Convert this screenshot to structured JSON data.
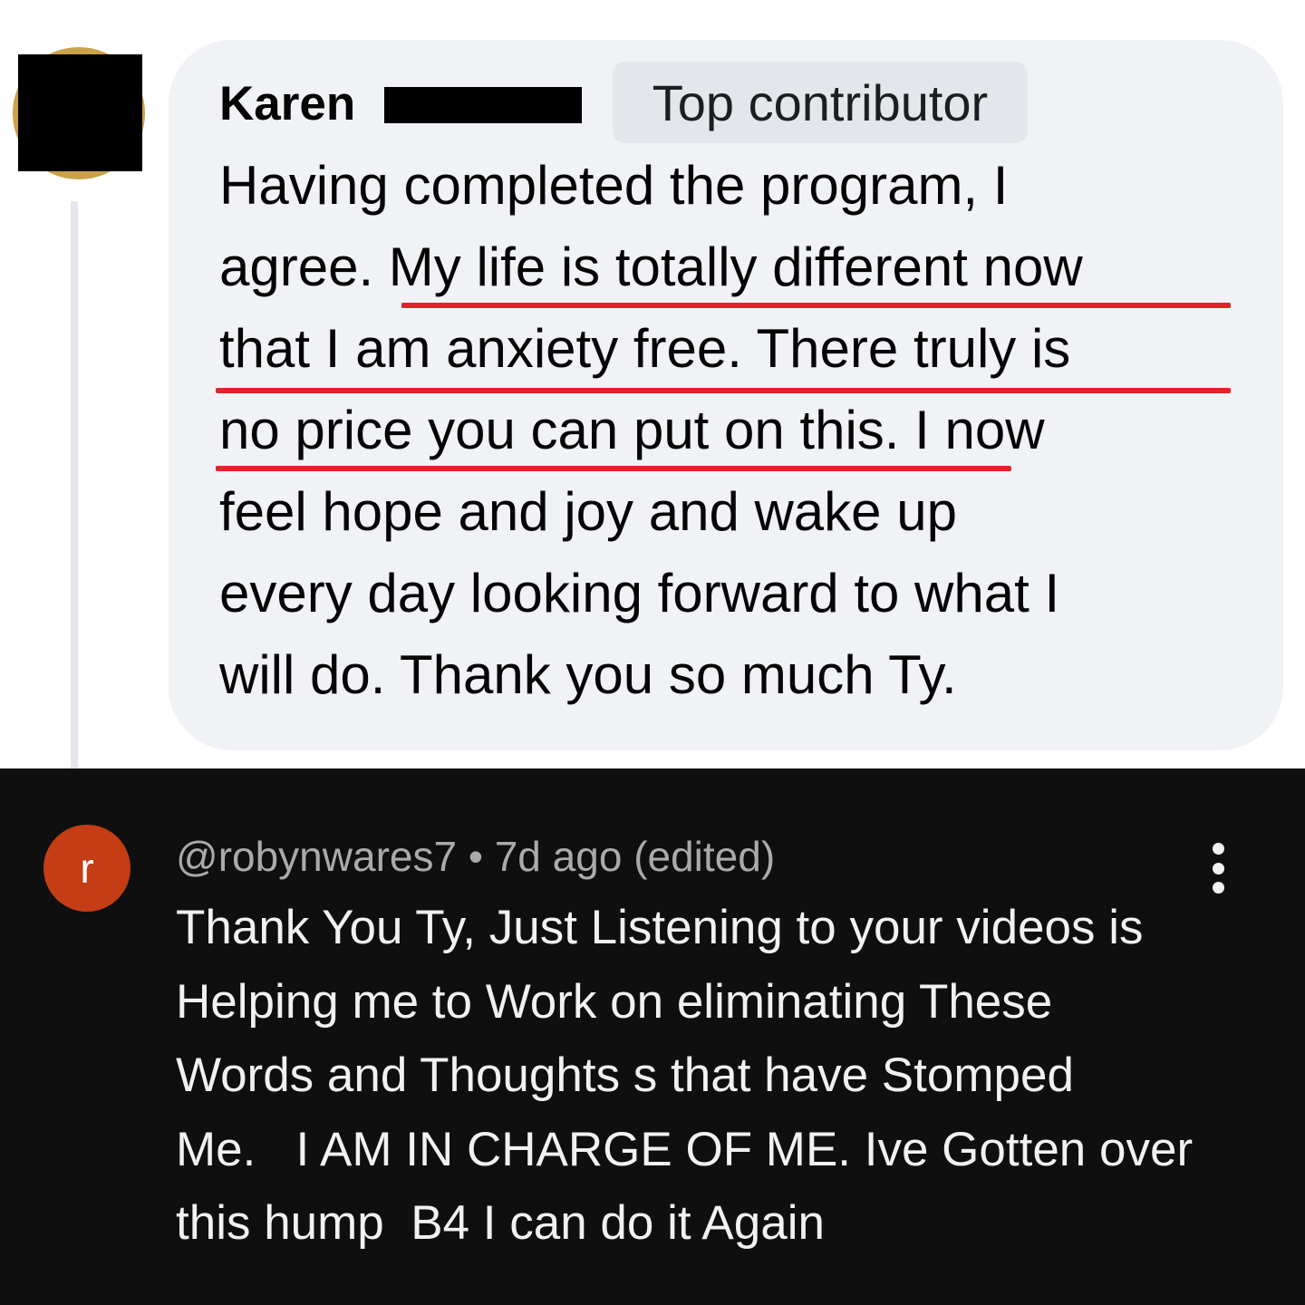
{
  "fb_comment": {
    "author_first_name": "Karen",
    "badge": "Top contributor",
    "lines": [
      "Having completed the program, I",
      "agree. My life is totally different now",
      "that I am anxiety free. There truly is",
      "no price you can put on this. I now",
      "feel hope and joy and wake up",
      "every day looking forward to what I",
      "will do. Thank you so much Ty."
    ],
    "highlight_color": "#e3232b"
  },
  "yt_comment": {
    "avatar_letter": "r",
    "avatar_color": "#c43d15",
    "meta": "@robynwares7 • 7d ago (edited)",
    "menu_icon": "more-vertical-icon",
    "lines": [
      "Thank You Ty, Just Listening to your videos is",
      "Helping me to Work on eliminating These",
      "Words and Thoughts s that have Stomped",
      "Me.   I AM IN CHARGE OF ME. Ive Gotten over",
      "this hump  B4 I can do it Again"
    ]
  }
}
